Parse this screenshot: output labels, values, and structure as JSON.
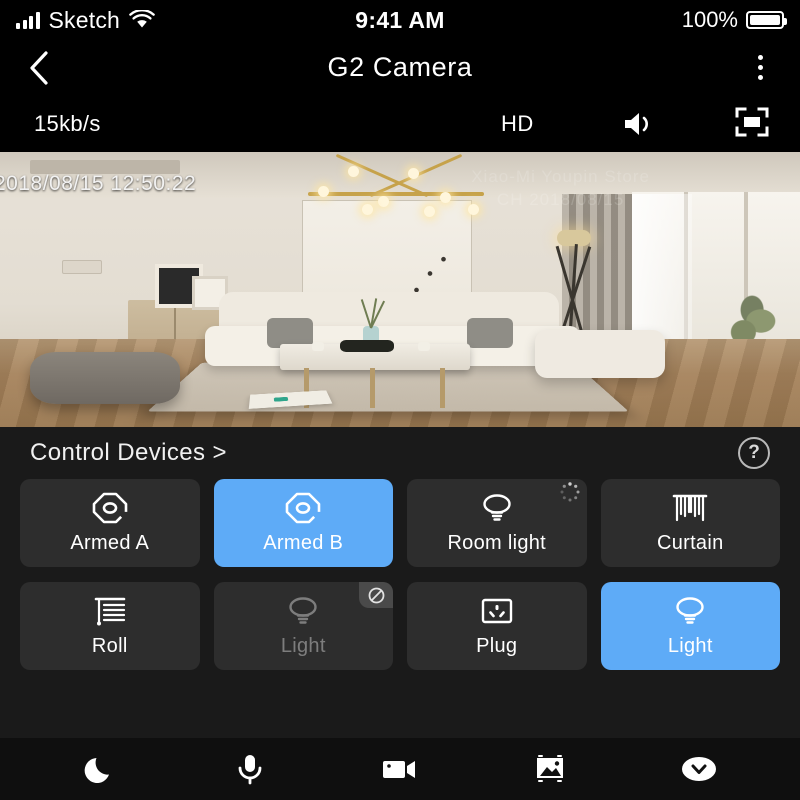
{
  "status_bar": {
    "carrier": "Sketch",
    "time": "9:41 AM",
    "battery_percent": "100%",
    "signal_icon": "signal-bars-icon",
    "wifi_icon": "wifi-icon",
    "battery_icon": "battery-full-icon"
  },
  "nav_bar": {
    "back_icon": "chevron-left-icon",
    "title": "G2 Camera",
    "more_icon": "more-vertical-icon"
  },
  "stream_bar": {
    "bitrate": "15kb/s",
    "quality": "HD",
    "speaker_icon": "speaker-on-icon",
    "fullscreen_icon": "fullscreen-icon"
  },
  "video": {
    "timestamp": "2018/08/15 12:50:22",
    "watermark_line1": "Xiao-Mi Youpin Store",
    "watermark_line2": "CH  2018/08/15"
  },
  "control_panel": {
    "title": "Control Devices >",
    "help_icon": "help-circle-icon",
    "devices": [
      {
        "label": "Armed A",
        "icon": "armed-hexagon-icon",
        "state": "idle",
        "badge": "none"
      },
      {
        "label": "Armed B",
        "icon": "armed-hexagon-icon",
        "state": "active",
        "badge": "none"
      },
      {
        "label": "Room light",
        "icon": "bulb-icon",
        "state": "idle",
        "badge": "loading-spinner-icon"
      },
      {
        "label": "Curtain",
        "icon": "curtain-icon",
        "state": "idle",
        "badge": "none"
      },
      {
        "label": "Roll",
        "icon": "roller-blind-icon",
        "state": "idle",
        "badge": "none"
      },
      {
        "label": "Light",
        "icon": "bulb-icon",
        "state": "disabled",
        "badge": "offline-prohibited-icon"
      },
      {
        "label": "Plug",
        "icon": "power-socket-icon",
        "state": "idle",
        "badge": "none"
      },
      {
        "label": "Light",
        "icon": "bulb-icon",
        "state": "active",
        "badge": "none"
      }
    ]
  },
  "bottom_bar": {
    "buttons": [
      {
        "name": "night-mode",
        "icon": "moon-icon"
      },
      {
        "name": "talk",
        "icon": "microphone-icon"
      },
      {
        "name": "record",
        "icon": "video-camera-icon"
      },
      {
        "name": "snapshot",
        "icon": "photo-gallery-icon"
      },
      {
        "name": "collapse",
        "icon": "chevron-down-circle-icon"
      }
    ]
  },
  "colors": {
    "accent_blue": "#5eabf7",
    "tile_dark": "#2d2d2d",
    "panel_bg": "#1a1a1a",
    "bar_bg": "#0f0f0f"
  }
}
